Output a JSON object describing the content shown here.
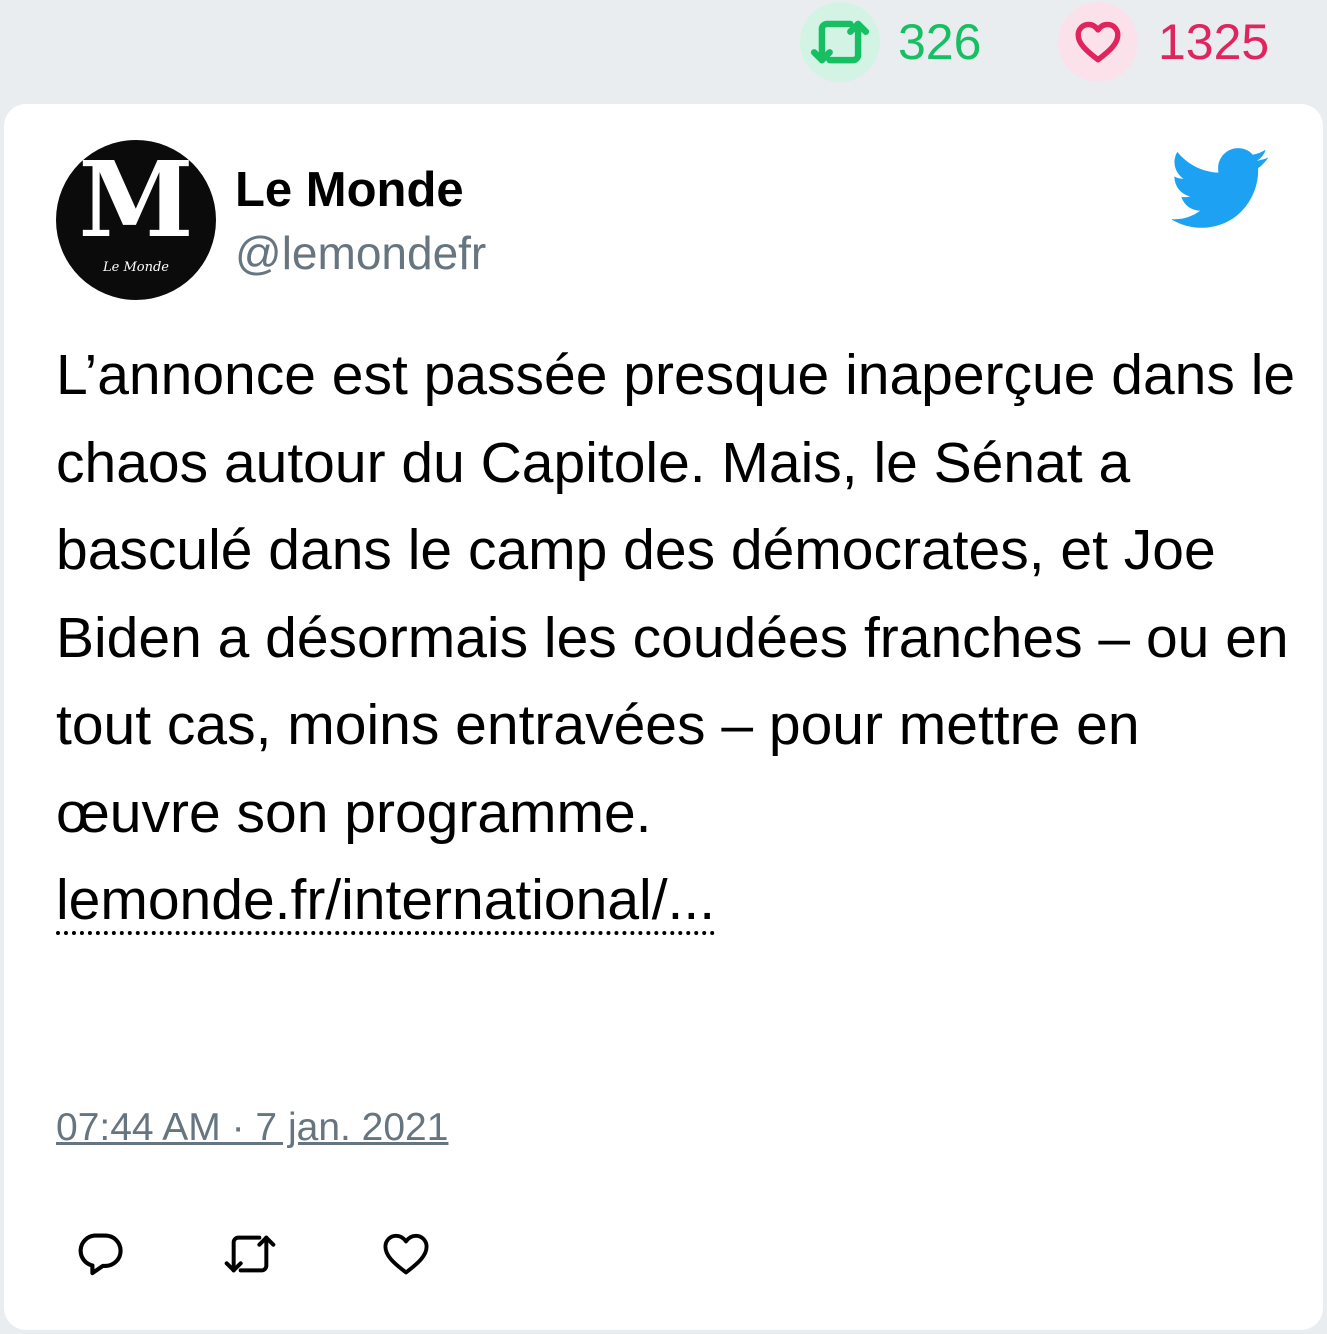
{
  "stats": {
    "retweets": "326",
    "likes": "1325",
    "retweet_icon": "retweet-icon",
    "like_icon": "heart-icon",
    "retweet_color": "#17bf63",
    "like_color": "#e0245e"
  },
  "tweet": {
    "author": {
      "name": "Le Monde",
      "handle": "@lemondefr",
      "avatar_letter": "M",
      "avatar_caption": "Le Monde"
    },
    "text": "L’annonce est passée presque inaperçue dans le chaos autour du Capitole. Mais, le Sénat a basculé dans le camp des démocrates, et Joe Biden a désormais les coudées franches – ou en tout cas, moins entravées – pour mettre en œuvre son programme.",
    "link": "lemonde.fr/international/...",
    "timestamp": "07:44 AM · 7 jan. 2021",
    "brand_icon": "twitter-bird-icon",
    "brand_color": "#1da1f2",
    "actions": [
      "reply-icon",
      "retweet-icon",
      "like-icon"
    ]
  }
}
